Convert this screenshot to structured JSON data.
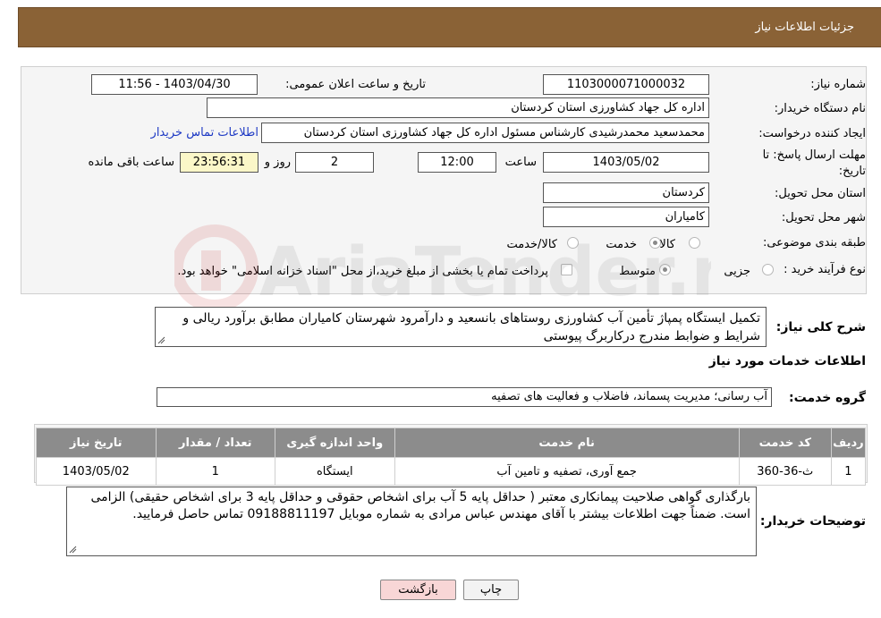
{
  "header": {
    "title": "جزئیات اطلاعات نیاز"
  },
  "form": {
    "need_number_label": "شماره نیاز:",
    "need_number": "1103000071000032",
    "announce_label": "تاریخ و ساعت اعلان عمومی:",
    "announce_value": "1403/04/30 - 11:56",
    "buyer_label": "نام دستگاه خریدار:",
    "buyer_value": "اداره کل جهاد کشاورزی استان کردستان",
    "creator_label": "ایجاد کننده درخواست:",
    "creator_value": "محمدسعید محمدرشیدی کارشناس مسئول اداره کل جهاد کشاورزی استان کردستان",
    "contact_link": "اطلاعات تماس خریدار",
    "deadline_label_1": "مهلت ارسال پاسخ: تا",
    "deadline_label_2": "تاریخ:",
    "deadline_date": "1403/05/02",
    "time_label": "ساعت",
    "deadline_time": "12:00",
    "days_value": "2",
    "days_label": "روز و",
    "remaining_value": "23:56:31",
    "remaining_label": "ساعت باقی مانده",
    "province_label": "استان محل تحویل:",
    "province_value": "کردستان",
    "city_label": "شهر محل تحویل:",
    "city_value": "کامیاران",
    "category_label": "طبقه بندی موضوعی:",
    "category_options": [
      "کالا",
      "خدمت",
      "کالا/خدمت"
    ],
    "category_selected": "خدمت",
    "process_label": "نوع فرآیند خرید :",
    "process_options": [
      "جزیی",
      "متوسط"
    ],
    "process_selected": "متوسط",
    "payment_note": "پرداخت تمام یا بخشی از مبلغ خرید،از محل \"اسناد خزانه اسلامی\" خواهد بود."
  },
  "description": {
    "label": "شرح کلی نیاز:",
    "text": "تکمیل ایستگاه پمپاژ تأمین آب کشاورزی روستاهای بانسعید و دارآمرود شهرستان کامیاران مطابق برآورد ریالی و شرایط و ضوابط مندرج درکاربرگ پیوستی"
  },
  "services_section": {
    "title": "اطلاعات خدمات مورد نیاز",
    "group_label": "گروه خدمت:",
    "group_value": "آب رسانی؛ مدیریت پسماند، فاضلاب و فعالیت های تصفیه"
  },
  "table": {
    "headers": [
      "ردیف",
      "کد خدمت",
      "نام خدمت",
      "واحد اندازه گیری",
      "تعداد / مقدار",
      "تاریخ نیاز"
    ],
    "rows": [
      [
        "1",
        "ث-36-360",
        "جمع آوری، تصفیه و تامین آب",
        "ایستگاه",
        "1",
        "1403/05/02"
      ]
    ]
  },
  "buyer_notes": {
    "label": "توضیحات خریدار:",
    "text": "بارگذاری گواهی صلاحیت پیمانکاری معتبر ( حداقل پایه 5 آب برای اشخاص حقوقی و حداقل پایه 3 برای اشخاص حقیقی) الزامی است. ضمناً جهت اطلاعات بیشتر با آقای مهندس عباس مرادی به شماره موبایل 09188811197 تماس حاصل فرمایید."
  },
  "buttons": {
    "print": "چاپ",
    "back": "بازگشت"
  },
  "colors": {
    "header_bg": "#8a6236",
    "table_header_bg": "#8c8c8c",
    "link": "#1d39c4",
    "back_button_bg": "#f8d6d6"
  }
}
